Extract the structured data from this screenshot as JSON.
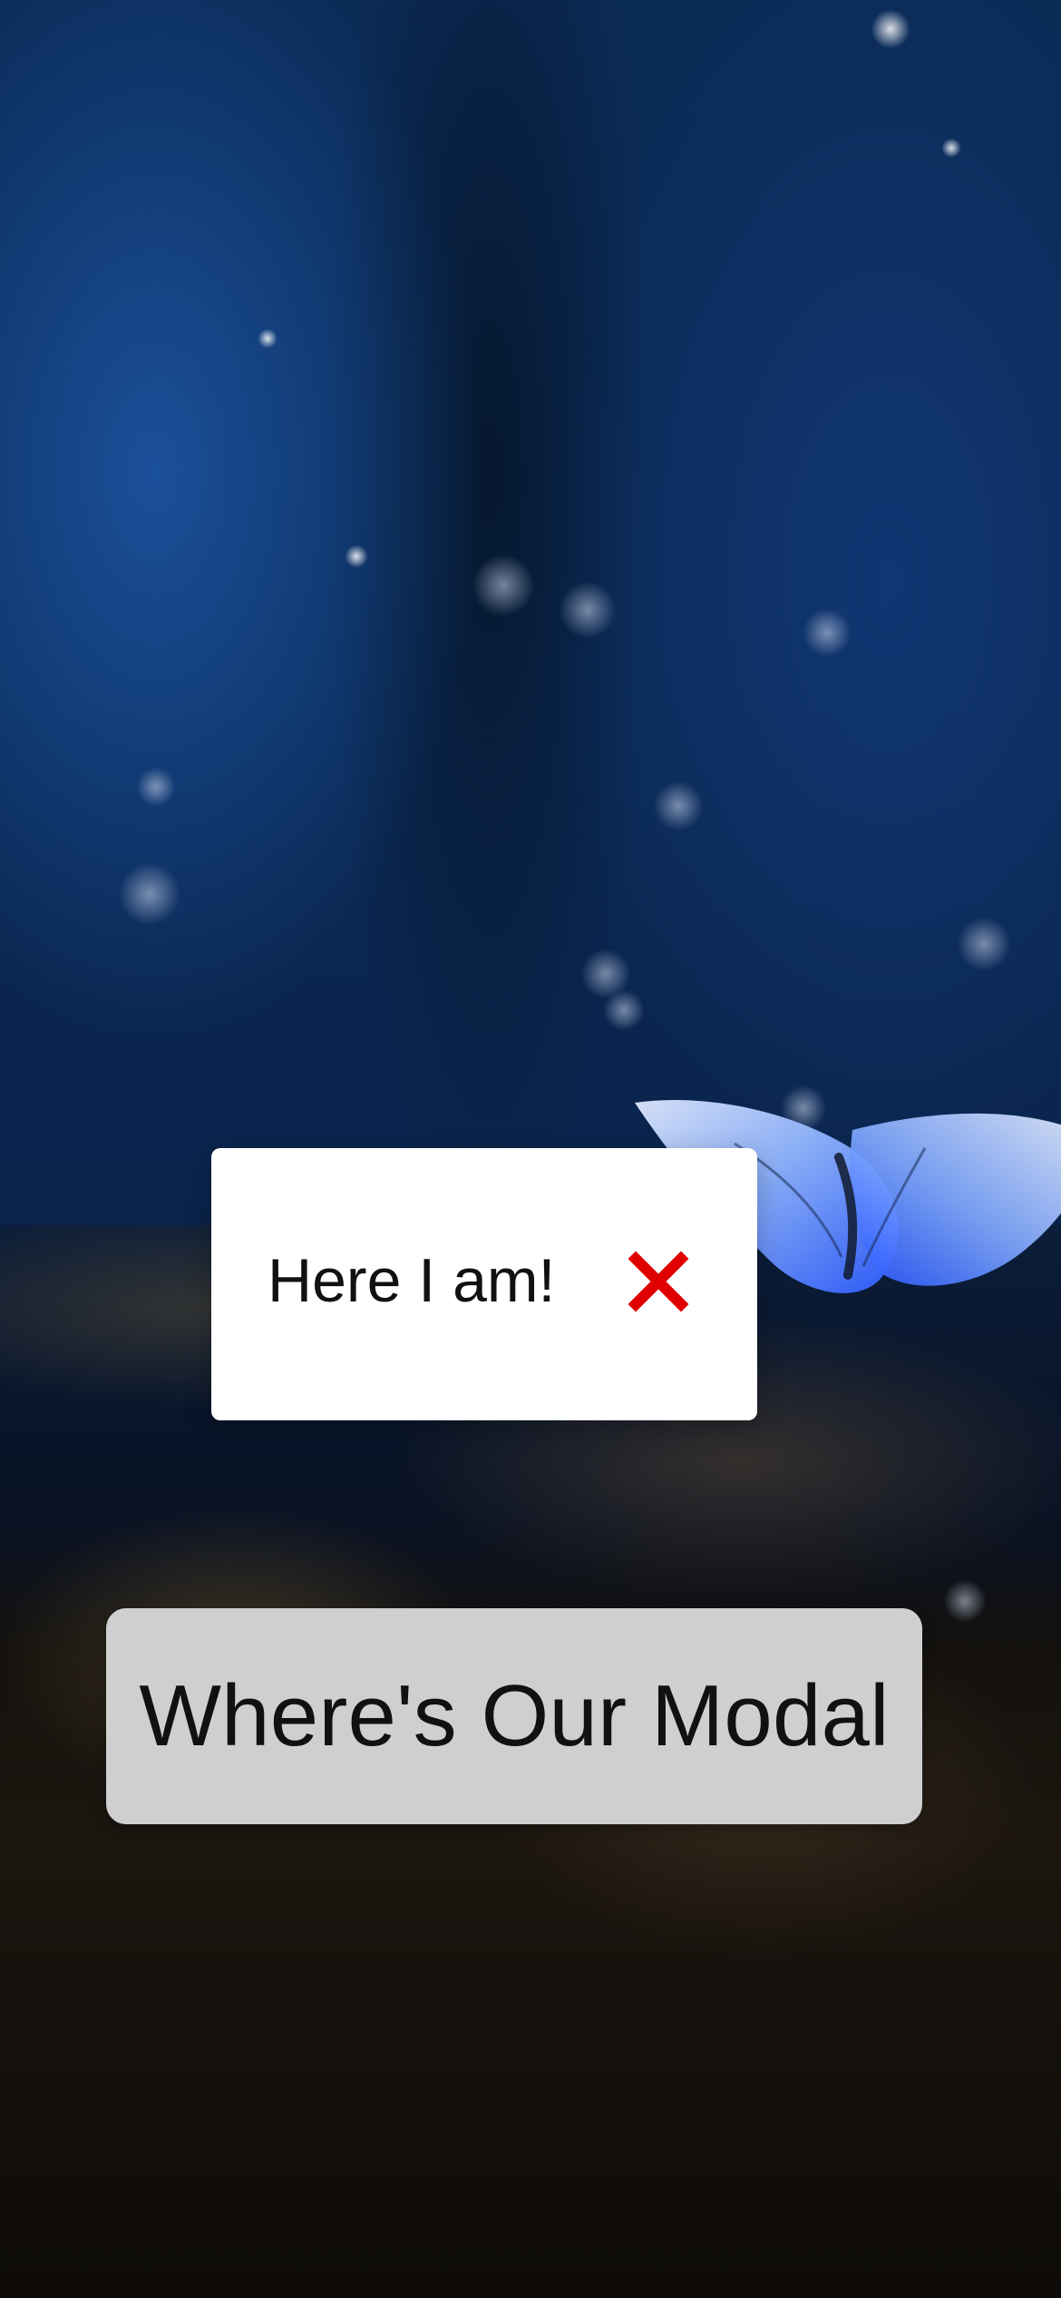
{
  "modal": {
    "message": "Here I am!",
    "close_icon": "close-icon",
    "close_color": "#e00000"
  },
  "actions": {
    "primary_label": "Where's Our Modal"
  },
  "background": {
    "subject": "butterfly"
  }
}
